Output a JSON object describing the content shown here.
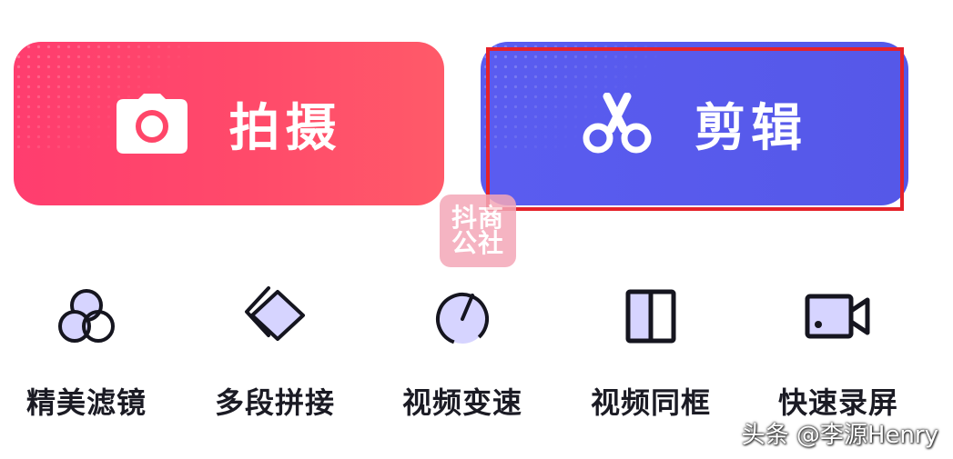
{
  "actions": {
    "shoot": {
      "label": "拍摄",
      "icon": "camera-icon",
      "color_start": "#ff3d6f",
      "color_end": "#ff5a69"
    },
    "edit": {
      "label": "剪辑",
      "icon": "scissors-icon",
      "color_start": "#5a5cf0",
      "color_end": "#5558e8"
    }
  },
  "highlight": {
    "color": "#e5222a"
  },
  "badge": {
    "line1": "抖商",
    "line2": "公社"
  },
  "tools": [
    {
      "label": "精美滤镜",
      "icon": "filter-circles-icon"
    },
    {
      "label": "多段拼接",
      "icon": "layers-icon"
    },
    {
      "label": "视频变速",
      "icon": "speed-gauge-icon"
    },
    {
      "label": "视频同框",
      "icon": "split-frame-icon"
    },
    {
      "label": "快速录屏",
      "icon": "video-camera-icon"
    }
  ],
  "credit": "头条 @李源Henry",
  "colors": {
    "icon_fill": "#d6d4ff",
    "icon_stroke": "#15151f",
    "label_text": "#1b1b24"
  }
}
